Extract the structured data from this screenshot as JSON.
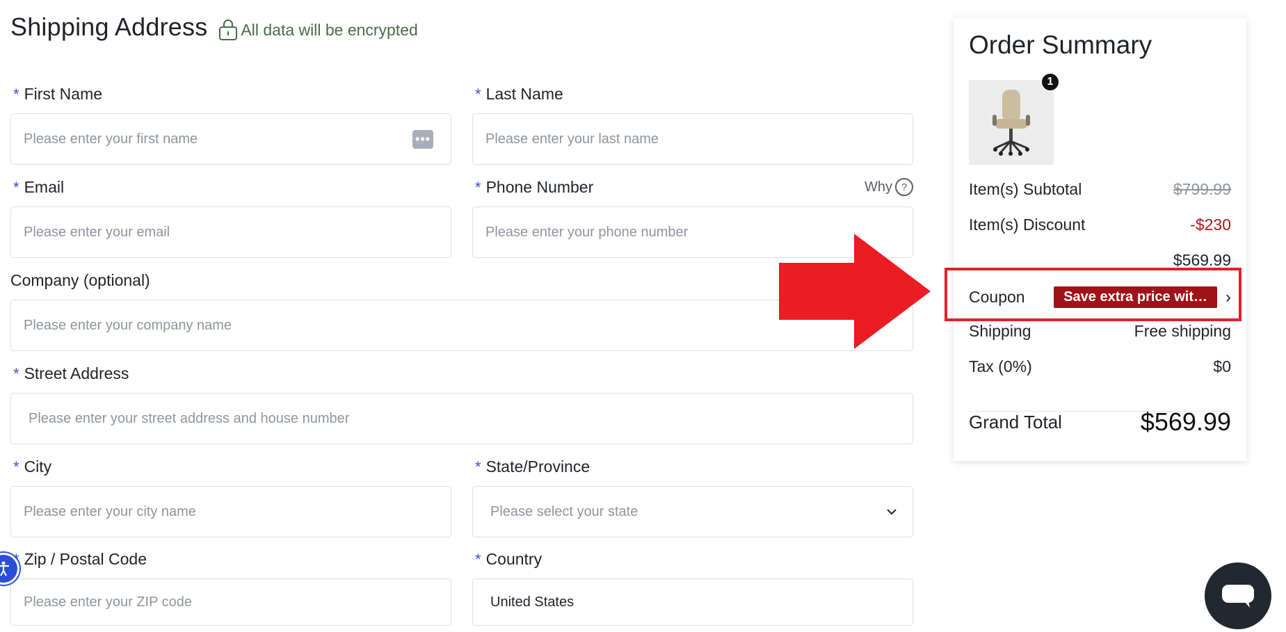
{
  "form": {
    "title": "Shipping Address",
    "encrypt_note": "All data will be encrypted",
    "required_mark": "*",
    "fields": {
      "first_name": {
        "label": "First Name",
        "placeholder": "Please enter your first name"
      },
      "last_name": {
        "label": "Last Name",
        "placeholder": "Please enter your last name"
      },
      "email": {
        "label": "Email",
        "placeholder": "Please enter your email"
      },
      "phone": {
        "label": "Phone Number",
        "placeholder": "Please enter your phone number",
        "help_label": "Why",
        "help_icon": "?"
      },
      "company": {
        "label": "Company (optional)",
        "placeholder": "Please enter your company name"
      },
      "street": {
        "label": "Street Address",
        "placeholder": "Please enter your street address and house number"
      },
      "city": {
        "label": "City",
        "placeholder": "Please enter your city name"
      },
      "state": {
        "label": "State/Province",
        "placeholder": "Please select your state"
      },
      "zip": {
        "label": "Zip / Postal Code",
        "placeholder": "Please enter your ZIP code"
      },
      "country": {
        "label": "Country",
        "value": "United States"
      }
    },
    "password_manager_icon": "•••"
  },
  "summary": {
    "title": "Order Summary",
    "item_quantity": "1",
    "rows": {
      "subtotal": {
        "label": "Item(s) Subtotal",
        "value": "$799.99"
      },
      "discount": {
        "label": "Item(s) Discount",
        "value": "-$230"
      },
      "after_discount": {
        "value": "$569.99"
      },
      "coupon": {
        "label": "Coupon",
        "tag": "Save extra price wit…",
        "chevron": "›"
      },
      "shipping": {
        "label": "Shipping",
        "value": "Free shipping"
      },
      "tax": {
        "label": "Tax (0%)",
        "value": "$0"
      },
      "grand_total": {
        "label": "Grand Total",
        "value": "$569.99"
      }
    }
  },
  "colors": {
    "accent_required": "#3b50d6",
    "discount_red": "#b1141c",
    "coupon_tag_bg": "#a11218",
    "annotation_red": "#e0202a",
    "encrypt_green": "#4a6b47"
  }
}
